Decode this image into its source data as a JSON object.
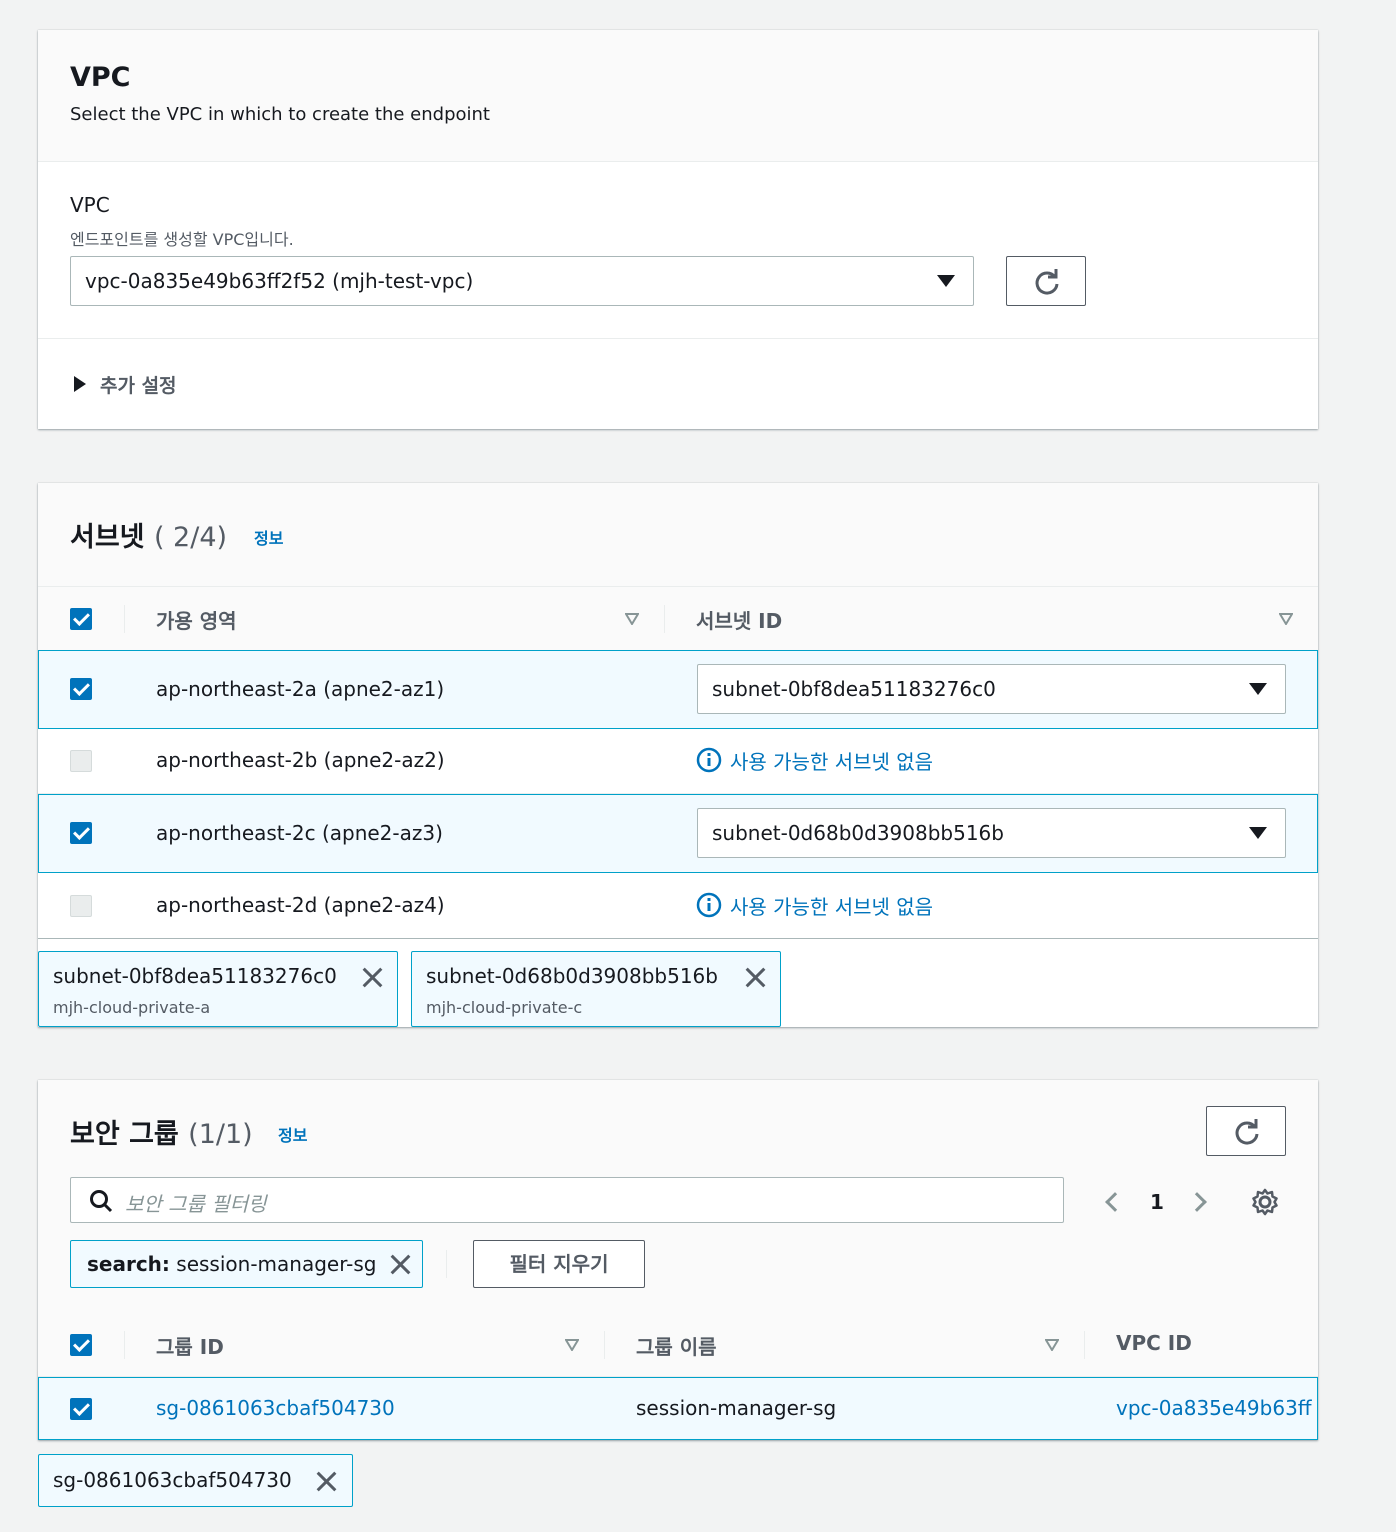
{
  "vpc_section": {
    "title": "VPC",
    "description": "Select the VPC in which to create the endpoint",
    "field_label": "VPC",
    "field_description": "엔드포인트를 생성할 VPC입니다.",
    "selected_vpc": "vpc-0a835e49b63ff2f52 (mjh-test-vpc)",
    "additional_settings": "추가 설정"
  },
  "subnet_section": {
    "title": "서브넷",
    "count": "( 2/4)",
    "info": "정보",
    "columns": [
      "가용 영역",
      "서브넷 ID"
    ],
    "rows": [
      {
        "az": "ap-northeast-2a (apne2-az1)",
        "subnet": "subnet-0bf8dea51183276c0",
        "checked": true
      },
      {
        "az": "ap-northeast-2b (apne2-az2)",
        "subnet": "사용 가능한 서브넷 없음",
        "checked": false
      },
      {
        "az": "ap-northeast-2c (apne2-az3)",
        "subnet": "subnet-0d68b0d3908bb516b",
        "checked": true
      },
      {
        "az": "ap-northeast-2d (apne2-az4)",
        "subnet": "사용 가능한 서브넷 없음",
        "checked": false
      }
    ],
    "tokens": [
      {
        "id": "subnet-0bf8dea51183276c0",
        "name": "mjh-cloud-private-a"
      },
      {
        "id": "subnet-0d68b0d3908bb516b",
        "name": "mjh-cloud-private-c"
      }
    ]
  },
  "sg_section": {
    "title": "보안 그룹",
    "count": "(1/1)",
    "info": "정보",
    "search_placeholder": "보안 그룹 필터링",
    "page": "1",
    "filter_token_key": "search:",
    "filter_token_value": "session-manager-sg",
    "clear_filters": "필터 지우기",
    "columns": [
      "그룹 ID",
      "그룹 이름",
      "VPC ID"
    ],
    "rows": [
      {
        "group_id": "sg-0861063cbaf504730",
        "group_name": "session-manager-sg",
        "vpc_id": "vpc-0a835e49b63ff"
      }
    ],
    "selected_token": "sg-0861063cbaf504730"
  },
  "colors": {
    "accent": "#0073bb",
    "selected_bg": "#f1faff",
    "selected_border": "#00a1c9"
  }
}
